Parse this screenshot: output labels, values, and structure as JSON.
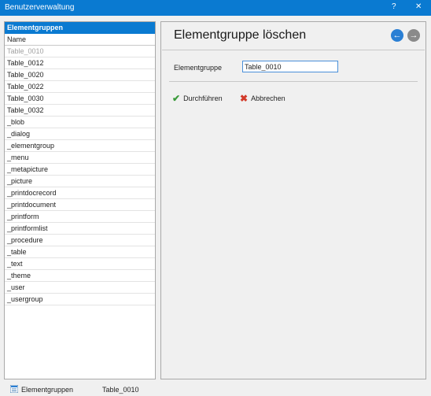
{
  "window": {
    "title": "Benutzerverwaltung",
    "help": "?",
    "close": "✕"
  },
  "left_panel": {
    "header": "Elementgruppen",
    "column": "Name",
    "items": [
      "Table_0010",
      "Table_0012",
      "Table_0020",
      "Table_0022",
      "Table_0030",
      "Table_0032",
      "_blob",
      "_dialog",
      "_elementgroup",
      "_menu",
      "_metapicture",
      "_picture",
      "_printdocrecord",
      "_printdocument",
      "_printform",
      "_printformlist",
      "_procedure",
      "_table",
      "_text",
      "_theme",
      "_user",
      "_usergroup"
    ]
  },
  "right_panel": {
    "title": "Elementgruppe löschen",
    "field_label": "Elementgruppe",
    "field_value": "Table_0010",
    "ok_label": "Durchführen",
    "cancel_label": "Abbrechen"
  },
  "status": {
    "label": "Elementgruppen",
    "value": "Table_0010"
  },
  "colors": {
    "accent": "#0a7ad1",
    "ok": "#3a9b3a",
    "cancel": "#d23a2a"
  }
}
